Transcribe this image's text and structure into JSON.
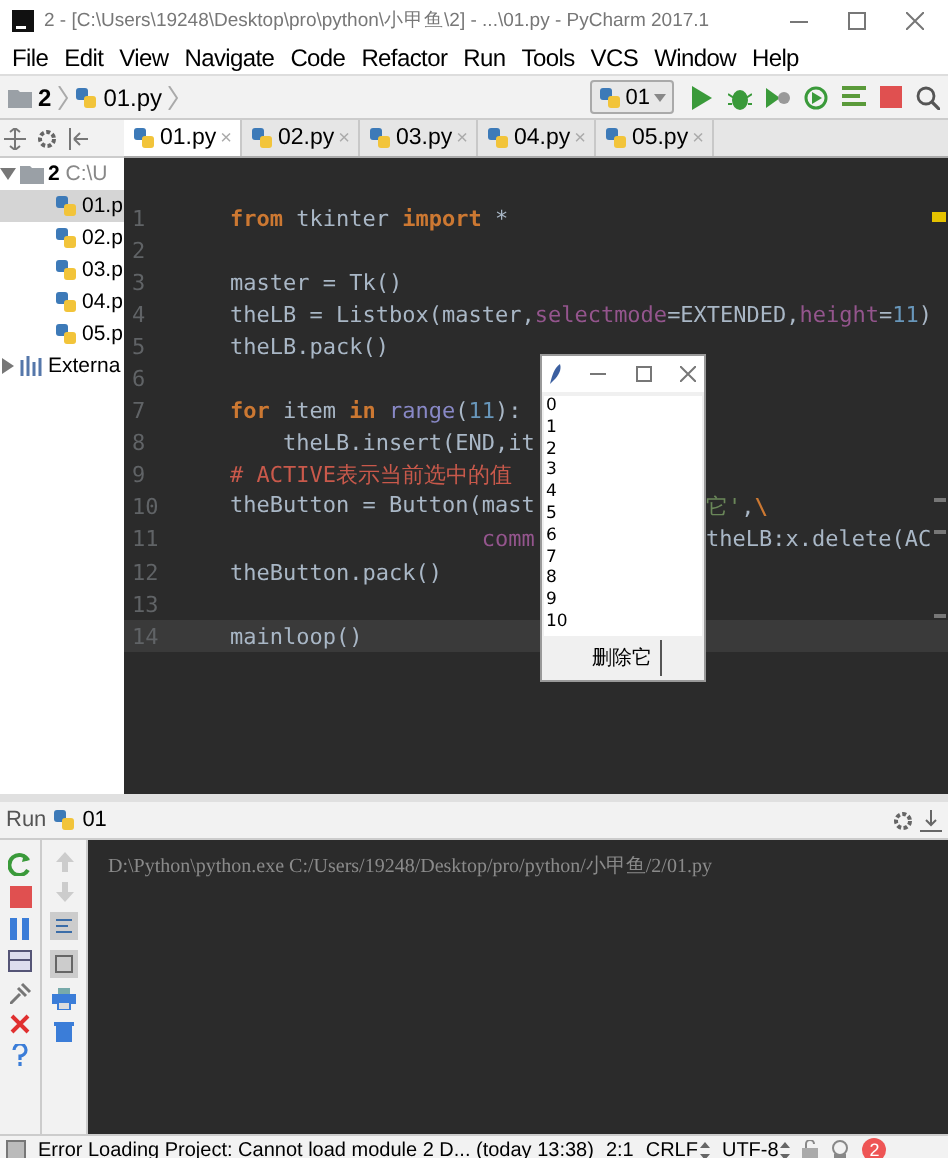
{
  "window": {
    "title": "2 - [C:\\Users\\19248\\Desktop\\pro\\python\\小甲鱼\\2] - ...\\01.py - PyCharm 2017.1"
  },
  "menu": [
    "File",
    "Edit",
    "View",
    "Navigate",
    "Code",
    "Refactor",
    "Run",
    "Tools",
    "VCS",
    "Window",
    "Help"
  ],
  "breadcrumb": [
    "2",
    "01.py"
  ],
  "run_config": {
    "label": "01"
  },
  "project": {
    "root": {
      "name": "2",
      "path": "C:\\U",
      "expanded": true,
      "children": [
        {
          "name": "01.p",
          "selected": true
        },
        {
          "name": "02.p",
          "selected": false
        },
        {
          "name": "03.p",
          "selected": false
        },
        {
          "name": "04.p",
          "selected": false
        },
        {
          "name": "05.p",
          "selected": false
        }
      ]
    },
    "external": {
      "name": "Externa",
      "expanded": false
    }
  },
  "tabs": [
    {
      "label": "01.py",
      "close": "×",
      "selected": true
    },
    {
      "label": "02.py",
      "close": "×",
      "selected": false
    },
    {
      "label": "03.py",
      "close": "×",
      "selected": false
    },
    {
      "label": "04.py",
      "close": "×",
      "selected": false
    },
    {
      "label": "05.py",
      "close": "×",
      "selected": false
    }
  ],
  "editor": {
    "lines": [
      {
        "num": "1",
        "current": false,
        "left": [
          {
            "kind": "kw",
            "text": "from"
          },
          {
            "kind": "plain",
            "text": " tkinter "
          },
          {
            "kind": "kw",
            "text": "import"
          },
          {
            "kind": "plain",
            "text": " *"
          }
        ]
      },
      {
        "num": "2",
        "current": false
      },
      {
        "num": "3",
        "current": false,
        "left": [
          {
            "kind": "plain",
            "text": "master = Tk()"
          }
        ]
      },
      {
        "num": "4",
        "current": false,
        "left": [
          {
            "kind": "plain",
            "text": "theLB = Listbox(master,"
          },
          {
            "kind": "arg",
            "text": "selectmode"
          },
          {
            "kind": "plain",
            "text": "=EXTENDED,"
          },
          {
            "kind": "arg",
            "text": "height"
          },
          {
            "kind": "plain",
            "text": "="
          },
          {
            "kind": "num",
            "text": "11"
          },
          {
            "kind": "plain",
            "text": ")"
          }
        ]
      },
      {
        "num": "5",
        "current": false,
        "left": [
          {
            "kind": "plain",
            "text": "theLB.pack()"
          }
        ]
      },
      {
        "num": "6",
        "current": false
      },
      {
        "num": "7",
        "current": false,
        "left": [
          {
            "kind": "kw",
            "text": "for"
          },
          {
            "kind": "plain",
            "text": " item "
          },
          {
            "kind": "kw",
            "text": "in"
          },
          {
            "kind": "builtin",
            "text": " range"
          },
          {
            "kind": "plain",
            "text": "("
          },
          {
            "kind": "num",
            "text": "11"
          },
          {
            "kind": "plain",
            "text": "):"
          }
        ]
      },
      {
        "num": "8",
        "current": false,
        "left": [
          {
            "kind": "plain",
            "text": "    theLB.insert(END,it"
          }
        ]
      },
      {
        "num": "9",
        "current": false,
        "left": [
          {
            "kind": "comment",
            "text": "# ACTIVE表示当前选中的值"
          }
        ]
      },
      {
        "num": "10",
        "current": false,
        "left": [
          {
            "kind": "plain",
            "text": "theButton = Button(mast"
          }
        ],
        "right": [
          {
            "kind": "str",
            "text": "它'"
          },
          {
            "kind": "plain",
            "text": ","
          },
          {
            "kind": "kw",
            "text": "\\"
          }
        ]
      },
      {
        "num": "11",
        "current": false,
        "left": [
          {
            "kind": "arg",
            "text": "                   comm"
          }
        ],
        "right": [
          {
            "kind": "plain",
            "text": "theLB:x.delete(AC"
          }
        ]
      },
      {
        "num": "12",
        "current": false,
        "left": [
          {
            "kind": "plain",
            "text": "theButton.pack()"
          }
        ]
      },
      {
        "num": "13",
        "current": false
      },
      {
        "num": "14",
        "current": true,
        "left": [
          {
            "kind": "plain",
            "text": "mainloop()"
          }
        ]
      }
    ]
  },
  "tk_window": {
    "items": [
      "0",
      "1",
      "2",
      "3",
      "4",
      "5",
      "6",
      "7",
      "8",
      "9",
      "10"
    ],
    "button": "删除它"
  },
  "run_panel": {
    "label": "Run",
    "config": "01",
    "console": "D:\\Python\\python.exe C:/Users/19248/Desktop/pro/python/小甲鱼/2/01.py"
  },
  "status_bar": {
    "message": "Error Loading Project: Cannot load module 2 D... (today 13:38)",
    "position": "2:1",
    "line_sep": "CRLF",
    "encoding": "UTF-8",
    "badge": "2"
  }
}
